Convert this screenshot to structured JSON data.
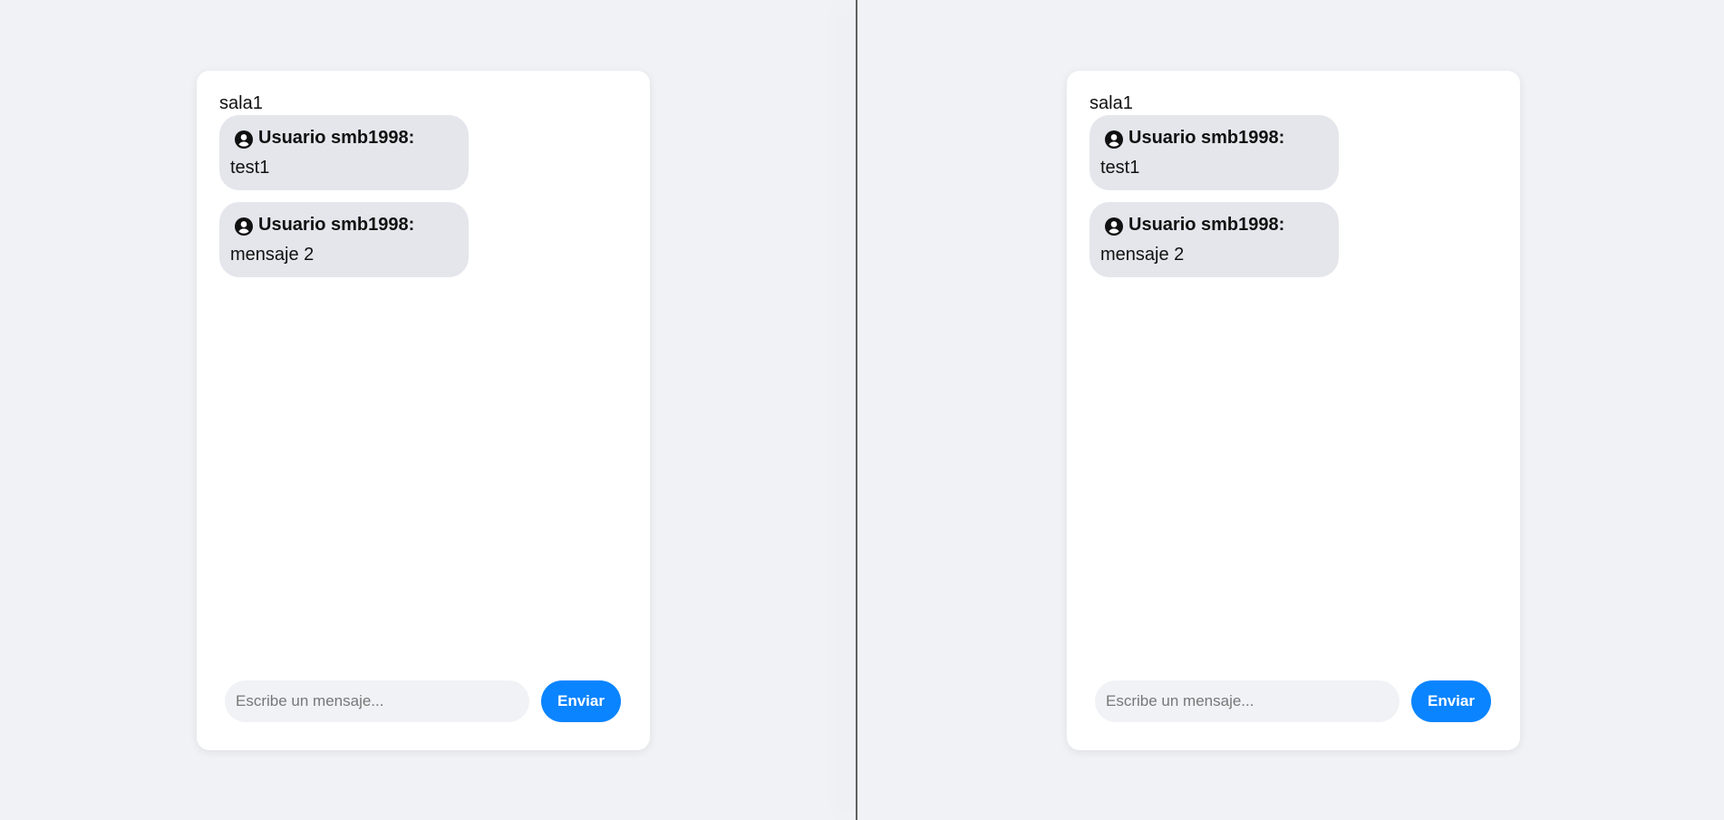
{
  "windows": [
    {
      "room": "sala1",
      "messages": [
        {
          "sender": "Usuario smb1998:",
          "text": "test1"
        },
        {
          "sender": "Usuario smb1998:",
          "text": "mensaje 2"
        }
      ],
      "input": {
        "value": "",
        "placeholder": "Escribe un mensaje..."
      },
      "send_label": "Enviar"
    },
    {
      "room": "sala1",
      "messages": [
        {
          "sender": "Usuario smb1998:",
          "text": "test1"
        },
        {
          "sender": "Usuario smb1998:",
          "text": "mensaje 2"
        }
      ],
      "input": {
        "value": "",
        "placeholder": "Escribe un mensaje..."
      },
      "send_label": "Enviar"
    }
  ],
  "colors": {
    "background": "#f0f2f5",
    "card": "#ffffff",
    "bubble": "#e4e6eb",
    "accent": "#0a84ff",
    "text": "#111111"
  },
  "icons": {
    "user": "user-circle-icon"
  }
}
